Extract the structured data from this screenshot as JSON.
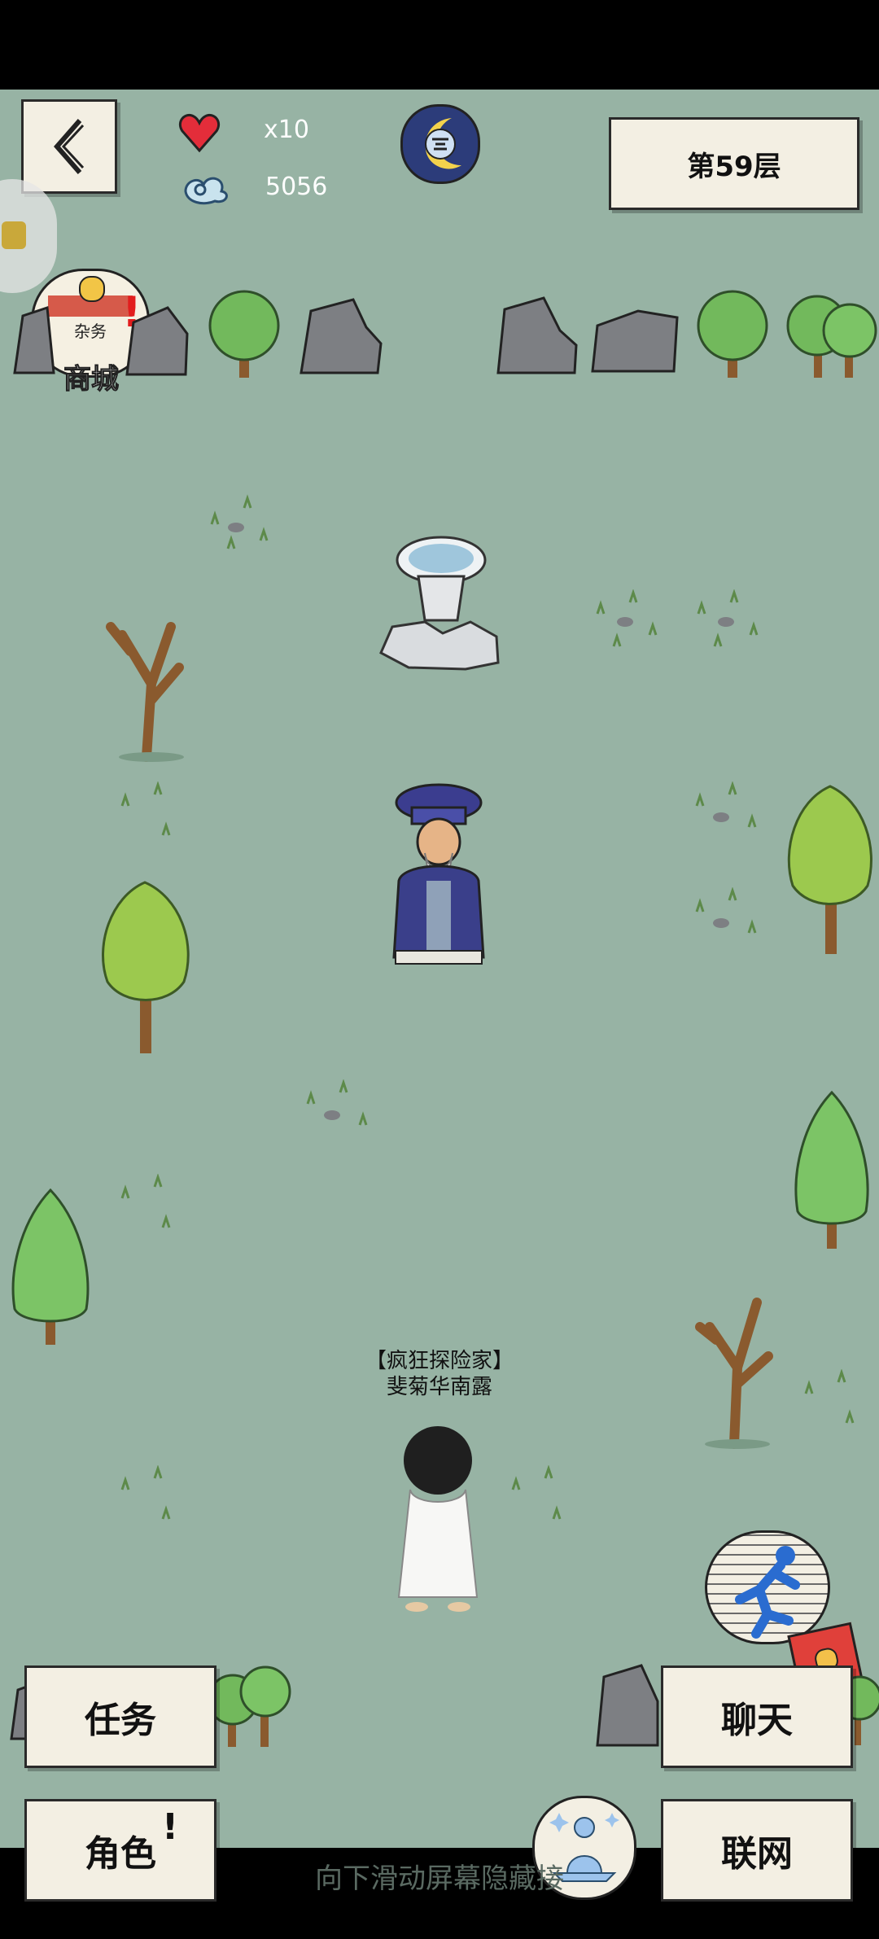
{
  "hud": {
    "lives_label": "x10",
    "coins_value": "5056",
    "floor_label": "第59层",
    "shop_label": "商城",
    "shop_sign": "杂务"
  },
  "player": {
    "title": "【疯狂探险家】",
    "name": "斐菊华南露"
  },
  "buttons": {
    "tasks": "任务",
    "chat": "聊天",
    "role": "角色",
    "role_badge": "!",
    "network": "联网"
  },
  "hint_text": "向下滑动屏幕隐藏接",
  "colors": {
    "ground": "#97b3a4",
    "card": "#f3efe3"
  }
}
